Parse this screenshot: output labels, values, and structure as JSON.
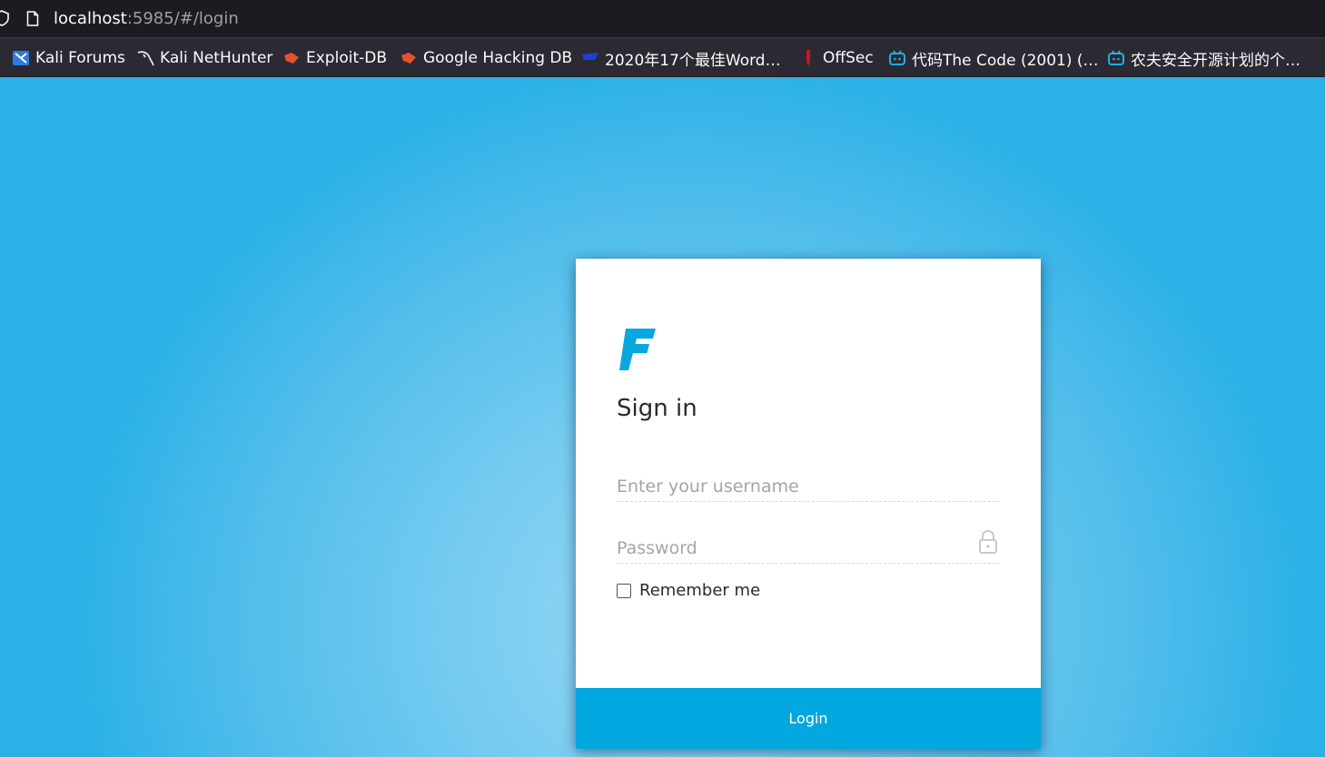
{
  "browser": {
    "url_host": "localhost",
    "url_rest": ":5985/#/login",
    "icons": {
      "tracking": "shield-icon",
      "page": "page-icon"
    }
  },
  "bookmarks": [
    {
      "label": "Kali Forums",
      "icon": "kali-forums-icon"
    },
    {
      "label": "Kali NetHunter",
      "icon": "kali-dragon-icon"
    },
    {
      "label": "Exploit-DB",
      "icon": "exploit-db-icon"
    },
    {
      "label": "Google Hacking DB",
      "icon": "ghdb-icon"
    },
    {
      "label": "2020年17个最佳Word…",
      "icon": "blue-bird-icon"
    },
    {
      "label": "OffSec",
      "icon": "offsec-icon"
    },
    {
      "label": "代码The Code (2001) (…",
      "icon": "bilibili-icon"
    },
    {
      "label": "农夫安全开源计划的个…",
      "icon": "bilibili-icon"
    }
  ],
  "login": {
    "title": "Sign in",
    "username_placeholder": "Enter your username",
    "password_placeholder": "Password",
    "remember_label": "Remember me",
    "remember_checked": false,
    "button_label": "Login"
  },
  "colors": {
    "accent": "#01a7df",
    "background_center": "#9ad8f4",
    "background_edge": "#2bb1e6"
  }
}
